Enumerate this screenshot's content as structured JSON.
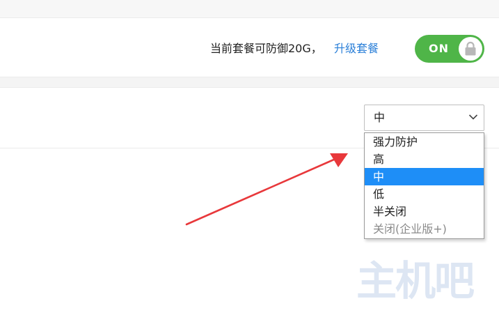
{
  "plan": {
    "text": "当前套餐可防御20G，",
    "upgrade_link": "升级套餐",
    "toggle_label": "ON",
    "toggle_state": "on"
  },
  "protection_level": {
    "selected": "中",
    "options": [
      {
        "label": "强力防护",
        "state": "normal"
      },
      {
        "label": "高",
        "state": "normal"
      },
      {
        "label": "中",
        "state": "selected"
      },
      {
        "label": "低",
        "state": "normal"
      },
      {
        "label": "半关闭",
        "state": "normal"
      },
      {
        "label": "关闭(企业版+)",
        "state": "disabled"
      }
    ]
  },
  "watermark": "主机吧",
  "colors": {
    "toggle_on": "#4fb548",
    "link": "#2a7fd8",
    "selected_option": "#1e8ef7",
    "arrow": "#e8383b"
  }
}
